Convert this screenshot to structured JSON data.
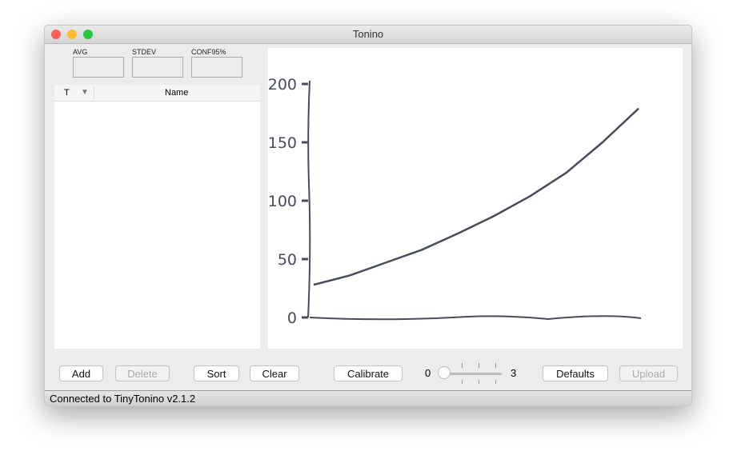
{
  "window": {
    "title": "Tonino"
  },
  "stats": {
    "avg_label": "AVG",
    "avg_value": "",
    "stdev_label": "STDEV",
    "stdev_value": "",
    "conf_label": "CONF95%",
    "conf_value": ""
  },
  "table": {
    "columns": [
      "T",
      "Name"
    ],
    "rows": []
  },
  "buttons": {
    "add": "Add",
    "delete": "Delete",
    "sort": "Sort",
    "clear": "Clear",
    "calibrate": "Calibrate",
    "defaults": "Defaults",
    "upload": "Upload"
  },
  "slider": {
    "min": "0",
    "max": "3",
    "value": 0
  },
  "status": "Connected to TinyTonino v2.1.2",
  "chart_data": {
    "type": "line",
    "ylim": [
      0,
      200
    ],
    "yticks": [
      "0",
      "50",
      "100",
      "150",
      "200"
    ],
    "grid": false,
    "series": [
      {
        "values": [
          28,
          36,
          47,
          58,
          72,
          87,
          104,
          124,
          150,
          179
        ],
        "color": "#474c5c"
      }
    ],
    "baseline": 0
  }
}
